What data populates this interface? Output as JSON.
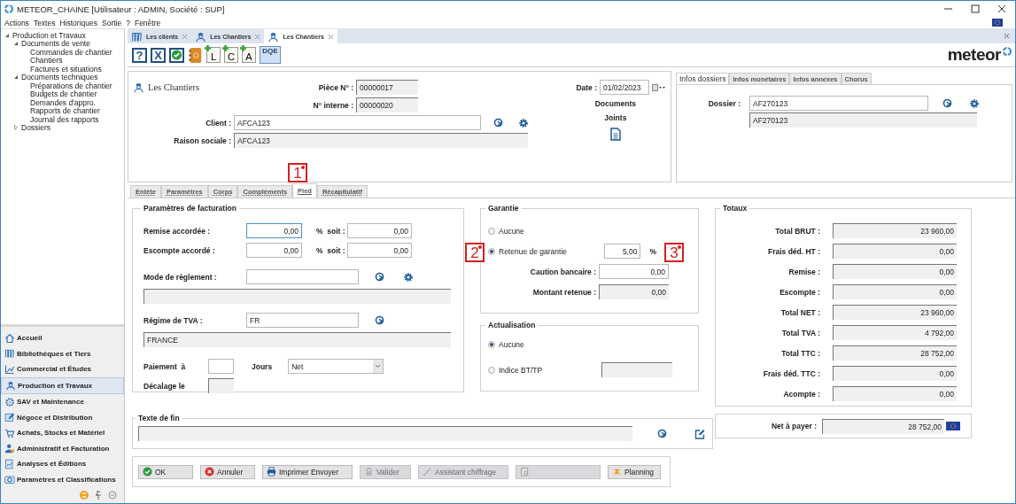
{
  "window": {
    "title": "METEOR_CHAINE [Utilisateur : ADMIN, Société : SUP]"
  },
  "menu": [
    "Actions",
    "Textes",
    "Historiques",
    "Sortie",
    "?",
    "Fenêtre"
  ],
  "tree": [
    {
      "label": "Production et Travaux",
      "expanded": true,
      "children": [
        {
          "label": "Documents de vente",
          "expanded": true,
          "children": [
            {
              "label": "Commandes de chantier"
            },
            {
              "label": "Chantiers"
            },
            {
              "label": "Factures et situations"
            }
          ]
        },
        {
          "label": "Documents techniques",
          "expanded": true,
          "children": [
            {
              "label": "Préparations de chantier"
            },
            {
              "label": "Budgets de chantier"
            },
            {
              "label": "Demandes d'appro."
            },
            {
              "label": "Rapports de chantier"
            },
            {
              "label": "Journal des rapports"
            }
          ]
        },
        {
          "label": "Dossiers",
          "expanded": false
        }
      ]
    }
  ],
  "modules": [
    {
      "label": "Accueil",
      "kind": "home",
      "selected": false
    },
    {
      "label": "Bibliothèques et Tiers",
      "kind": "books",
      "selected": false
    },
    {
      "label": "Commercial et Études",
      "kind": "chart",
      "selected": false
    },
    {
      "label": "Production et Travaux",
      "kind": "worker",
      "selected": true
    },
    {
      "label": "SAV et Maintenance",
      "kind": "gear",
      "selected": false
    },
    {
      "label": "Négoce et Distribution",
      "kind": "pen",
      "selected": false
    },
    {
      "label": "Achats, Stocks et Matériel",
      "kind": "cart",
      "selected": false
    },
    {
      "label": "Administratif et Facturation",
      "kind": "money",
      "selected": false
    },
    {
      "label": "Analyses et Éditions",
      "kind": "report",
      "selected": false
    },
    {
      "label": "Paramètres et Classifications",
      "kind": "camera",
      "selected": false
    }
  ],
  "doc_tabs": [
    {
      "label": "Les clients",
      "kind": "books",
      "selected": false
    },
    {
      "label": "Les Chantiers",
      "kind": "worker",
      "selected": false
    },
    {
      "label": "Les Chantiers",
      "kind": "worker",
      "selected": true
    }
  ],
  "toolbar": [
    {
      "kind": "help",
      "glyph": "?"
    },
    {
      "kind": "close",
      "glyph": "X"
    },
    {
      "kind": "ok"
    },
    {
      "kind": "book"
    },
    {
      "kind": "add",
      "glyph": "L"
    },
    {
      "kind": "add",
      "glyph": "C"
    },
    {
      "kind": "add",
      "glyph": "A"
    },
    {
      "kind": "dqe",
      "glyph": "DQE"
    }
  ],
  "logo": "meteor",
  "header": {
    "title": "Les Chantiers",
    "piece": {
      "label": "Pièce N° :",
      "value": "00000017"
    },
    "interne": {
      "label": "N° interne :",
      "value": "00000020"
    },
    "client": {
      "label": "Client :",
      "value": "AFCA123"
    },
    "raison": {
      "label": "Raison sociale :",
      "value": "AFCA123"
    },
    "date": {
      "label": "Date :",
      "value": "01/02/2023"
    },
    "documents": [
      "Documents",
      "Joints"
    ]
  },
  "info_tabs": [
    {
      "label": "Infos dossiers",
      "selected": true
    },
    {
      "label": "Infos monétaires",
      "selected": false
    },
    {
      "label": "Infos annexes",
      "selected": false
    },
    {
      "label": "Chorus",
      "selected": false
    }
  ],
  "dossier": {
    "label": "Dossier :",
    "value": "AF270123",
    "description": "AF270123"
  },
  "form_tabs": [
    {
      "label": "Entête",
      "selected": false
    },
    {
      "label": "Paramètres",
      "selected": false
    },
    {
      "label": "Corps",
      "selected": false
    },
    {
      "label": "Compléments",
      "selected": false
    },
    {
      "label": "Pied",
      "selected": true
    },
    {
      "label": "Récapitulatif",
      "selected": false
    }
  ],
  "facturation": {
    "title": "Paramètres de facturation",
    "rates": [
      {
        "label": "Remise accordée :",
        "value": "0,00",
        "focused": true,
        "soit_label": "%  soit :",
        "soit_value": "0,00"
      },
      {
        "label": "Escompte accordé :",
        "value": "0,00",
        "focused": false,
        "soit_label": "%  soit :",
        "soit_value": "0,00"
      }
    ],
    "mode": {
      "label": "Mode de règlement :"
    },
    "tva": {
      "label": "Régime de TVA :",
      "value": "FR",
      "description": "FRANCE"
    },
    "paiement": {
      "label": "Paiement  à",
      "unit": "Jours",
      "select": "Net"
    },
    "decalage": {
      "label": "Décalage le"
    }
  },
  "garantie": {
    "title": "Garantie",
    "options": [
      {
        "label": "Aucune",
        "selected": false
      },
      {
        "label": "Retenue de garantie",
        "selected": true,
        "value": "5,00",
        "unit": "%"
      }
    ],
    "fields": [
      {
        "label": "Caution bancaire :",
        "value": "0,00",
        "readonly": false
      },
      {
        "label": "Montant retenue :",
        "value": "0,00",
        "readonly": true
      }
    ]
  },
  "actualisation": {
    "title": "Actualisation",
    "options": [
      {
        "label": "Aucune",
        "selected": true
      },
      {
        "label": "Indice BT/TP",
        "selected": false
      }
    ]
  },
  "totaux": {
    "title": "Totaux",
    "rows": [
      {
        "label": "Total BRUT :",
        "value": "23 960,00"
      },
      {
        "label": "Frais déd. HT :",
        "value": "0,00"
      },
      {
        "label": "Remise :",
        "value": "0,00"
      },
      {
        "label": "Escompte :",
        "value": "0,00"
      },
      {
        "label": "Total NET :",
        "value": "23 960,00"
      },
      {
        "label": "Total TVA :",
        "value": "4 792,00"
      },
      {
        "label": "Total TTC :",
        "value": "28 752,00"
      },
      {
        "label": "Frais déd. TTC :",
        "value": "0,00"
      },
      {
        "label": "Acompte :",
        "value": "0,00"
      }
    ]
  },
  "net": {
    "label": "Net à payer :",
    "value": "28 752,00"
  },
  "texte_fin": {
    "title": "Texte de fin"
  },
  "buttons": [
    {
      "label": "OK",
      "kind": "ok",
      "disabled": false
    },
    {
      "label": "Annuler",
      "kind": "cancel",
      "disabled": false
    },
    {
      "label": "Imprimer Envoyer",
      "kind": "print",
      "disabled": false
    },
    {
      "label": "Valider",
      "kind": "lock",
      "disabled": true
    },
    {
      "label": "Assistant chiffrage",
      "kind": "wand",
      "disabled": true
    },
    {
      "kind": "calc",
      "disabled": true
    },
    {
      "label": "Planning",
      "kind": "planning",
      "disabled": false
    }
  ],
  "callouts": [
    "1",
    "2",
    "3"
  ]
}
